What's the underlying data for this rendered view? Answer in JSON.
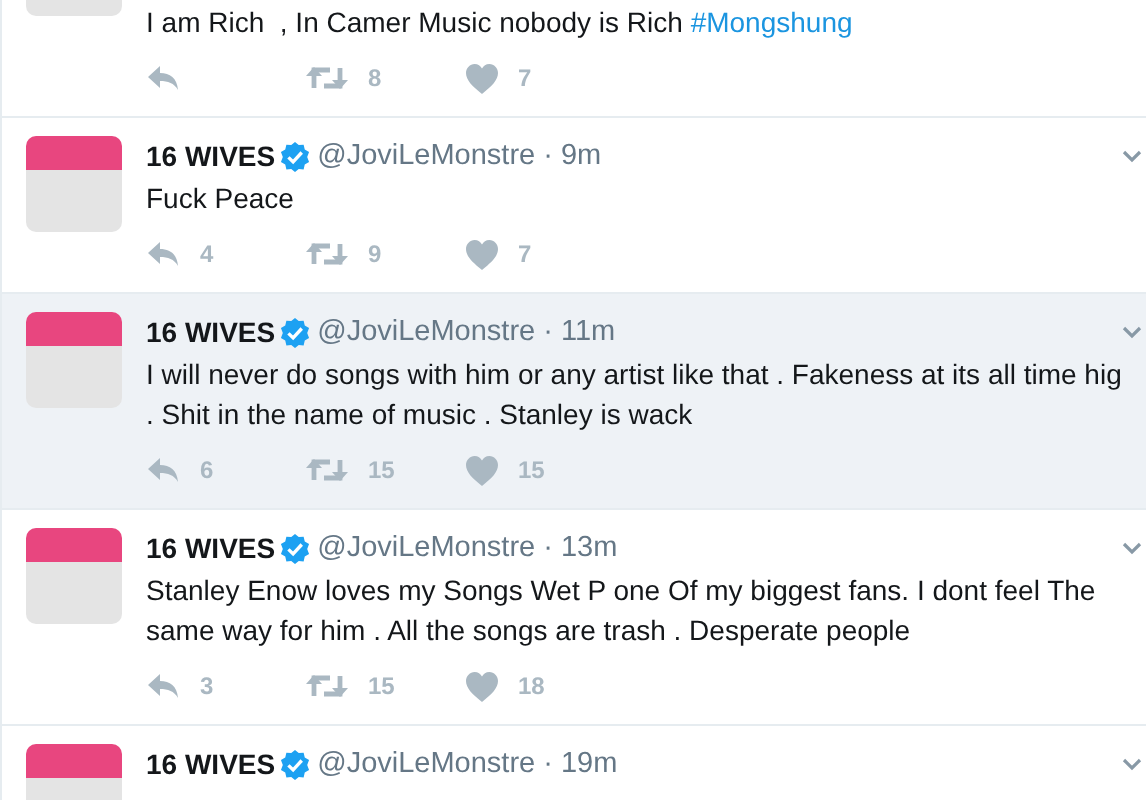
{
  "tweets": [
    {
      "kind": "partial",
      "text": "I am Rich  , In Camer Music nobody is Rich ",
      "hashtag": "#Mongshung",
      "highlighted": false,
      "retweets": "8",
      "likes": "7"
    },
    {
      "kind": "full",
      "name": "16 WIVES",
      "verified": true,
      "handle": "@JoviLeMonstre",
      "time": "· 9m",
      "text": "Fuck Peace",
      "highlighted": false,
      "replies": "4",
      "retweets": "9",
      "likes": "7"
    },
    {
      "kind": "full",
      "name": "16 WIVES",
      "verified": true,
      "handle": "@JoviLeMonstre",
      "time": "· 11m",
      "text": "I will never do songs with him or any artist like that . Fakeness at its all time hig\n. Shit in the name of music . Stanley is wack",
      "highlighted": true,
      "replies": "6",
      "retweets": "15",
      "likes": "15"
    },
    {
      "kind": "full",
      "name": "16 WIVES",
      "verified": true,
      "handle": "@JoviLeMonstre",
      "time": "· 13m",
      "text": "Stanley Enow loves my Songs Wet P one Of my biggest fans. I dont feel The same way for him . All the songs are trash . Desperate people",
      "highlighted": false,
      "replies": "3",
      "retweets": "15",
      "likes": "18"
    },
    {
      "kind": "header",
      "name": "16 WIVES",
      "verified": true,
      "handle": "@JoviLeMonstre",
      "time": "· 19m",
      "highlighted": false
    }
  ]
}
